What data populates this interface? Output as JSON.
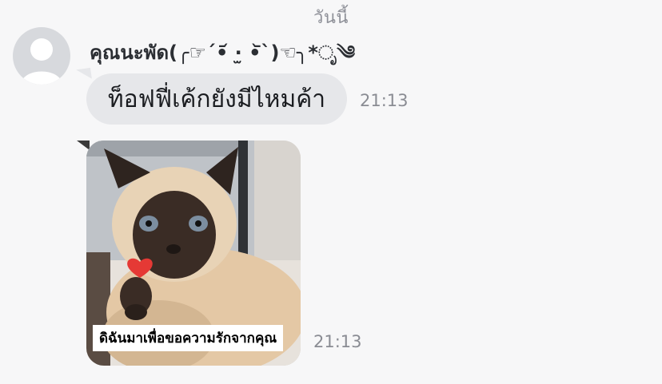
{
  "chat": {
    "date_separator": "วันนี้",
    "sender_name": "คุณนะพัด(╭☞ˊ•᷄ ·̫ •᷅ˋ)☜╮*ೃ༄",
    "messages": [
      {
        "type": "text",
        "text": "ท็อฟฟี่เค้กยังมีไหมค้า",
        "time": "21:13"
      },
      {
        "type": "sticker",
        "caption": "ดิฉันมาเพื่อขอความรักจากคุณ",
        "time": "21:13",
        "image": "siamese-cat-heart-sticker"
      }
    ]
  },
  "colors": {
    "background": "#f7f7f8",
    "bubble": "#e6e7ea",
    "time_text": "#8a8c93",
    "heart": "#e53935"
  }
}
